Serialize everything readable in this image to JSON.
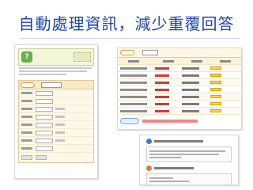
{
  "slide": {
    "title": "自動處理資訊，減少重覆回答"
  },
  "screenshot_health": {
    "banner_logo_text": "?"
  },
  "colors": {
    "title": "#1f47a8",
    "form_border": "#e2c79b",
    "highlight": "#ffd84a",
    "warning_text": "#c04040",
    "advice": "#2461b3"
  }
}
